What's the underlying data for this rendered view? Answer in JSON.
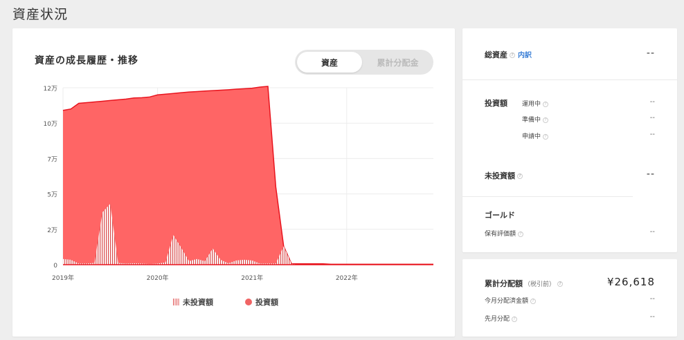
{
  "page": {
    "title": "資産状況"
  },
  "chart_section": {
    "heading": "資産の成長履歴・推移",
    "toggle": {
      "active_label": "資産",
      "inactive_label": "累計分配金"
    }
  },
  "legend": {
    "uninvested": "未投資額",
    "invested": "投資額"
  },
  "colors": {
    "invested_fill": "#ff6565",
    "invested_line": "#e8141e",
    "uninvested_hatch": "#d94a4a",
    "link": "#3b7fd6"
  },
  "chart_data": {
    "type": "area",
    "title": "",
    "xlabel": "",
    "ylabel": "",
    "ylim": [
      0,
      125000
    ],
    "y_ticks": [
      0,
      25000,
      50000,
      75000,
      100000,
      125000
    ],
    "y_tick_labels": [
      "0",
      "2万",
      "5万",
      "7万",
      "10万",
      "12万"
    ],
    "x_ticks": [
      "2019-01",
      "2020-01",
      "2021-01",
      "2022-01"
    ],
    "x_tick_labels": [
      "2019年",
      "2020年",
      "2021年",
      "2022年"
    ],
    "xlim": [
      "2019-01",
      "2022-12"
    ],
    "series": [
      {
        "name": "投資額",
        "x": [
          "2019-01",
          "2019-02",
          "2019-03",
          "2019-04",
          "2019-05",
          "2019-06",
          "2019-07",
          "2019-08",
          "2019-09",
          "2019-10",
          "2019-11",
          "2019-12",
          "2020-01",
          "2020-02",
          "2020-03",
          "2020-04",
          "2020-05",
          "2020-06",
          "2020-07",
          "2020-08",
          "2020-09",
          "2020-10",
          "2020-11",
          "2020-12",
          "2021-01",
          "2021-02",
          "2021-03",
          "2021-04",
          "2021-05",
          "2021-06",
          "2021-07",
          "2021-08",
          "2021-09",
          "2021-10",
          "2021-11",
          "2021-12",
          "2022-01",
          "2022-02",
          "2022-03",
          "2022-04",
          "2022-05",
          "2022-06",
          "2022-07",
          "2022-08",
          "2022-09",
          "2022-10",
          "2022-11",
          "2022-12"
        ],
        "values": [
          109000,
          110000,
          114000,
          114500,
          115000,
          115500,
          116000,
          116500,
          117000,
          117800,
          118000,
          118500,
          120000,
          120500,
          121000,
          121500,
          122000,
          122300,
          122700,
          123000,
          123300,
          123600,
          124000,
          124300,
          124700,
          125500,
          126000,
          55000,
          13000,
          600,
          600,
          600,
          600,
          600,
          300,
          300,
          300,
          300,
          300,
          300,
          300,
          300,
          300,
          300,
          300,
          300,
          300,
          300
        ]
      },
      {
        "name": "未投資額",
        "x": [
          "2019-01",
          "2019-02",
          "2019-03",
          "2019-04",
          "2019-05",
          "2019-06",
          "2019-07",
          "2019-08",
          "2019-09",
          "2019-10",
          "2019-11",
          "2019-12",
          "2020-01",
          "2020-02",
          "2020-03",
          "2020-04",
          "2020-05",
          "2020-06",
          "2020-07",
          "2020-08",
          "2020-09",
          "2020-10",
          "2020-11",
          "2020-12",
          "2021-01",
          "2021-02",
          "2021-03",
          "2021-04",
          "2021-05",
          "2021-06",
          "2021-07",
          "2021-08",
          "2021-09",
          "2021-10",
          "2021-11",
          "2021-12",
          "2022-01",
          "2022-02",
          "2022-03",
          "2022-04",
          "2022-05",
          "2022-06",
          "2022-07",
          "2022-08",
          "2022-09",
          "2022-10",
          "2022-11",
          "2022-12"
        ],
        "values": [
          4000,
          3500,
          800,
          800,
          1200,
          37000,
          43000,
          1200,
          800,
          1000,
          800,
          500,
          800,
          1500,
          21000,
          12000,
          2500,
          4000,
          2500,
          11500,
          3500,
          1000,
          3000,
          3500,
          3000,
          800,
          800,
          800,
          13000,
          600,
          0,
          0,
          0,
          0,
          0,
          0,
          0,
          0,
          0,
          0,
          0,
          0,
          0,
          0,
          0,
          0,
          0,
          0
        ]
      }
    ],
    "legend": [
      "未投資額",
      "投資額"
    ],
    "legend_position": "bottom-center",
    "grid": true
  },
  "summary": {
    "total_assets": {
      "label": "総資産",
      "link": "内訳",
      "value": "--"
    },
    "investment": {
      "label": "投資額",
      "items": [
        {
          "label": "運用中",
          "value": "--"
        },
        {
          "label": "準備中",
          "value": "--"
        },
        {
          "label": "申請中",
          "value": "--"
        }
      ]
    },
    "uninvested": {
      "label": "未投資額",
      "value": "--"
    },
    "gold": {
      "label": "ゴールド",
      "sub_label": "保有評価額",
      "value": "--"
    }
  },
  "distribution": {
    "label": "累計分配額",
    "tax_note": "（税引前）",
    "value": "¥26,618",
    "this_month_label": "今月分配済金額",
    "this_month_value": "--",
    "last_month_label": "先月分配",
    "last_month_value": "--"
  }
}
